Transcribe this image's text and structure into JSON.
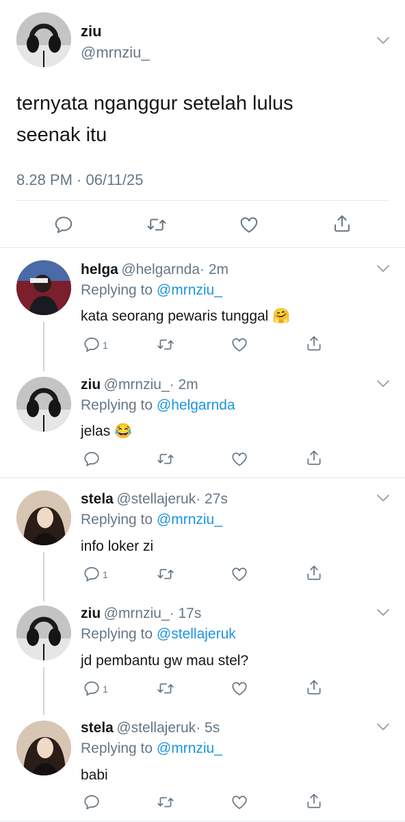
{
  "main_tweet": {
    "name": "ziu",
    "handle": "@mrnziu_",
    "text_line1": "ternyata nganggur setelah lulus",
    "text_line2": "seenak itu",
    "timestamp": "8.28 PM · 06/11/25"
  },
  "replies": [
    {
      "name": "helga",
      "handle": "@helgarnda",
      "time": "· 2m",
      "replying_label": "Replying to",
      "replying_to": "@mrnziu_",
      "text": "kata seorang pewaris tunggal",
      "emoji": "🤗",
      "reply_count": "1"
    },
    {
      "name": "ziu",
      "handle": "@mrnziu_",
      "time": "· 2m",
      "replying_label": "Replying to",
      "replying_to": "@helgarnda",
      "text": "jelas",
      "emoji": "😂",
      "reply_count": ""
    },
    {
      "name": "stela",
      "handle": "@stellajeruk",
      "time": "· 27s",
      "replying_label": "Replying to",
      "replying_to": "@mrnziu_",
      "text": "info loker zi",
      "emoji": "",
      "reply_count": "1"
    },
    {
      "name": "ziu",
      "handle": "@mrnziu_",
      "time": "· 17s",
      "replying_label": "Replying to",
      "replying_to": "@stellajeruk",
      "text": "jd pembantu gw mau stel?",
      "emoji": "",
      "reply_count": "1"
    },
    {
      "name": "stela",
      "handle": "@stellajeruk",
      "time": "· 5s",
      "replying_label": "Replying to",
      "replying_to": "@mrnziu_",
      "text": "babi",
      "emoji": "",
      "reply_count": ""
    }
  ],
  "icons": {
    "reply": "reply-icon",
    "retweet": "retweet-icon",
    "like": "heart-icon",
    "share": "share-icon",
    "more": "chevron-down-icon"
  },
  "colors": {
    "link": "#1b95e0",
    "muted": "#657786",
    "text": "#14171a",
    "divider": "#e1e8ed"
  }
}
